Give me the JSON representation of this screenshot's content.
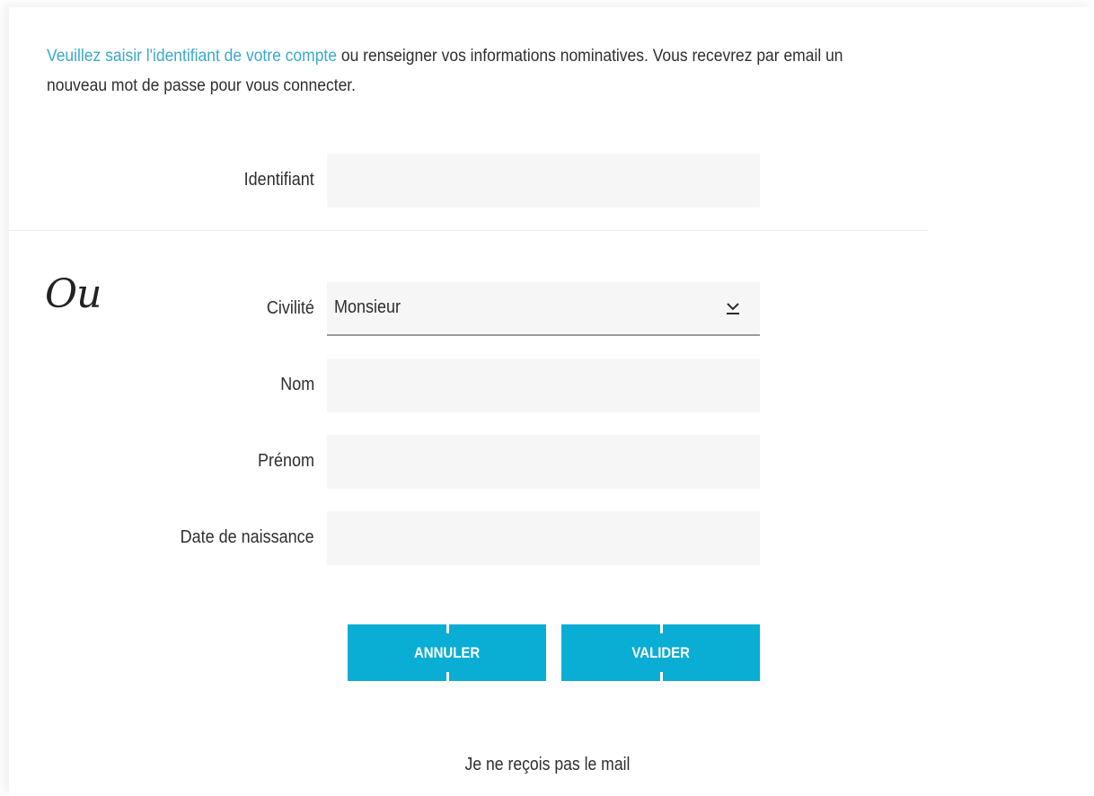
{
  "intro": {
    "link_text": "Veuillez saisir l'identifiant de votre compte",
    "rest_text": " ou renseigner vos informations nominatives. Vous recevrez par email un nouveau mot de passe pour vous connecter."
  },
  "identifiant": {
    "label": "Identifiant",
    "value": ""
  },
  "separator_text": "Ou",
  "civilite": {
    "label": "Civilité",
    "selected": "Monsieur"
  },
  "nom": {
    "label": "Nom",
    "value": ""
  },
  "prenom": {
    "label": "Prénom",
    "value": ""
  },
  "date_naissance": {
    "label": "Date de naissance",
    "value": ""
  },
  "buttons": {
    "cancel": "ANNULER",
    "submit": "VALIDER"
  },
  "no_mail_link": "Je ne reçois pas le mail",
  "colors": {
    "accent": "#0aadd3",
    "link": "#3aa9c9",
    "field_bg": "#f6f6f6"
  },
  "icons": {
    "select_arrow": "chevron-down-icon"
  }
}
